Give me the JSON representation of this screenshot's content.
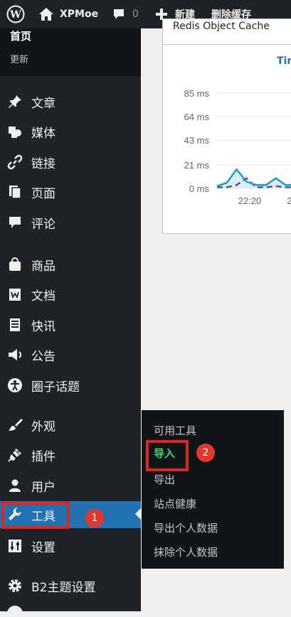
{
  "adminbar": {
    "site_name": "XPMoe",
    "comment_count": "0",
    "new_label": "新建",
    "purge_label": "删除缓存"
  },
  "sidebar": {
    "home": "首页",
    "update": "更新",
    "items": [
      {
        "label": "文章",
        "icon": "pushpin-icon"
      },
      {
        "label": "媒体",
        "icon": "media-icon"
      },
      {
        "label": "链接",
        "icon": "link-icon"
      },
      {
        "label": "页面",
        "icon": "page-icon"
      },
      {
        "label": "评论",
        "icon": "comment-icon"
      },
      {
        "label": "商品",
        "icon": "bag-icon"
      },
      {
        "label": "文档",
        "icon": "doc-icon"
      },
      {
        "label": "快讯",
        "icon": "newspaper-icon"
      },
      {
        "label": "公告",
        "icon": "megaphone-icon"
      },
      {
        "label": "圈子话题",
        "icon": "accessibility-icon"
      },
      {
        "label": "外观",
        "icon": "brush-icon"
      },
      {
        "label": "插件",
        "icon": "plugin-icon"
      },
      {
        "label": "用户",
        "icon": "user-icon"
      },
      {
        "label": "工具",
        "icon": "wrench-icon"
      },
      {
        "label": "设置",
        "icon": "sliders-icon"
      },
      {
        "label": "B2主题设置",
        "icon": "gear-icon"
      }
    ]
  },
  "flyout": {
    "items": [
      "可用工具",
      "导入",
      "导出",
      "站点健康",
      "导出个人数据",
      "抹除个人数据"
    ]
  },
  "annotations": {
    "badge1": "1",
    "badge2": "2"
  },
  "panel": {
    "title": "Redis Object Cache",
    "tab": "Tir"
  },
  "chart_data": {
    "type": "line",
    "title": "",
    "xlabel": "",
    "ylabel": "",
    "y_ticks": [
      "85 ms",
      "64 ms",
      "43 ms",
      "21 ms",
      "0 ms"
    ],
    "x_ticks": [
      "22:20",
      "2"
    ],
    "ylim": [
      0,
      85
    ],
    "series": [
      {
        "values": [
          2,
          5,
          17,
          6,
          3,
          3,
          9,
          3,
          3,
          8
        ]
      },
      {
        "values": [
          1,
          1,
          3,
          9,
          1,
          1,
          2,
          1,
          1,
          2
        ]
      }
    ],
    "colors": {
      "primary": "#1a9bd7",
      "secondary": "#555c62",
      "fill": "#cfe6f5"
    }
  }
}
